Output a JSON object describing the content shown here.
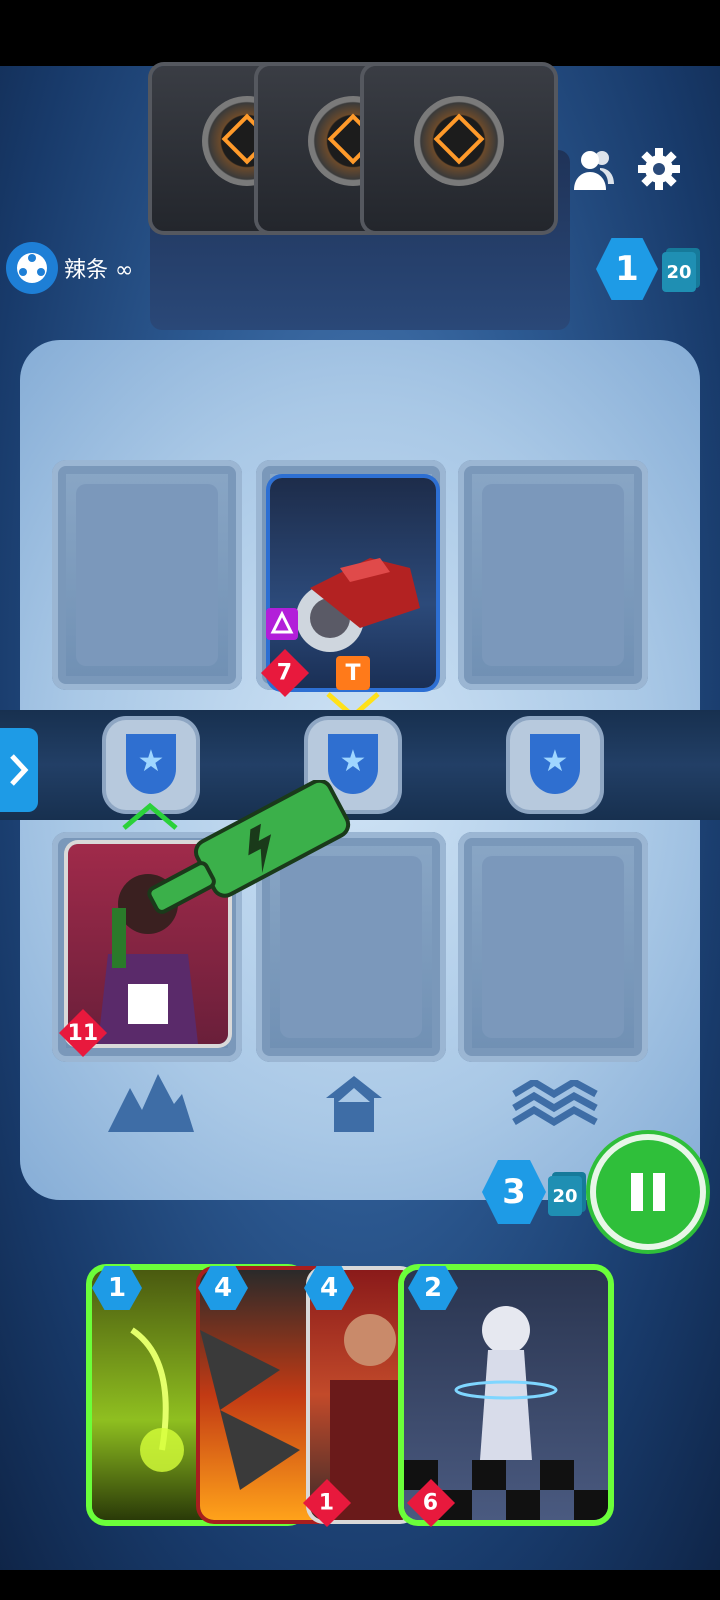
{
  "player": {
    "name": "辣条 ∞"
  },
  "opponent_energy": {
    "value": "1",
    "deck_count": "20"
  },
  "player_energy": {
    "value": "3",
    "deck_count": "20"
  },
  "board": {
    "opponent_card": {
      "cost_badge": "",
      "power": "7",
      "tag": "T"
    },
    "player_card": {
      "power": "11"
    }
  },
  "hand": [
    {
      "cost": "1"
    },
    {
      "cost": "4"
    },
    {
      "cost": "4",
      "power": "1"
    },
    {
      "cost": "2",
      "power": "6"
    }
  ],
  "colors": {
    "accent_green": "#2fbf3a",
    "energy_blue": "#1e9be6",
    "power_red": "#e8193d",
    "tag_orange": "#ff7a1a"
  },
  "icons": {
    "settings": "gear-icon",
    "friends": "friends-icon",
    "undo": "undo-icon",
    "end_turn": "pause-icon",
    "lane_expand": "chevron-right-icon"
  }
}
